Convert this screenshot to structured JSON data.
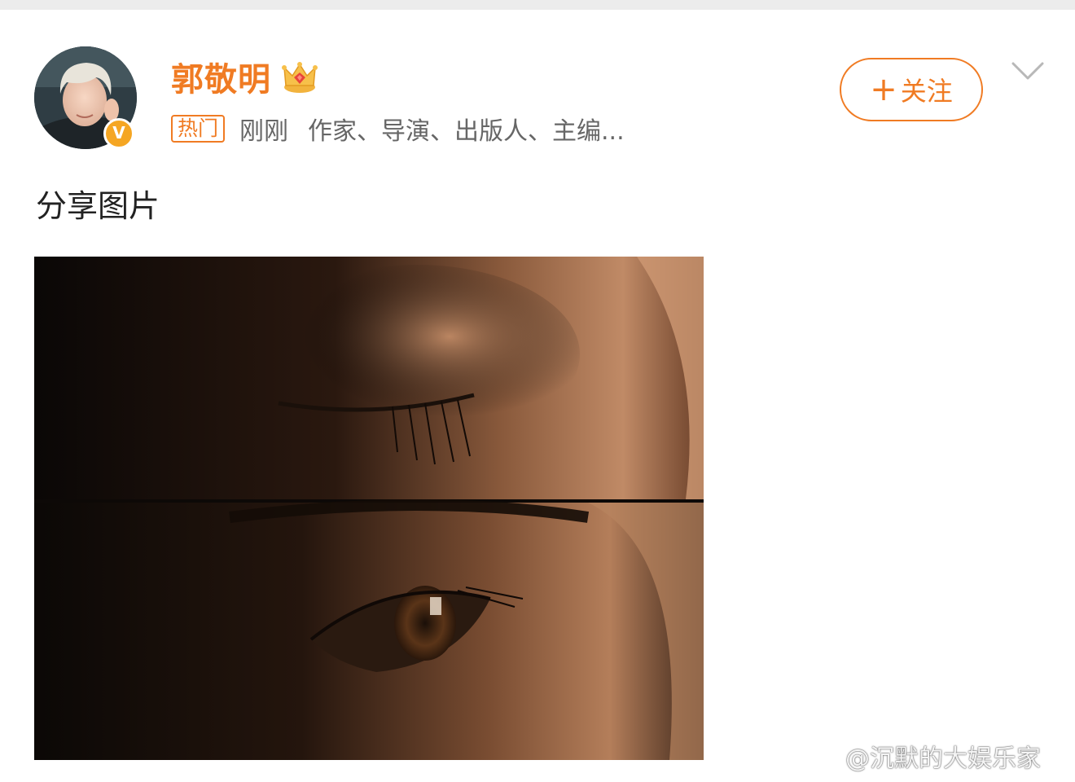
{
  "profile": {
    "username": "郭敬明",
    "verified_badge": "V",
    "hot_tag": "热门",
    "time": "刚刚",
    "bio": "作家、导演、出版人、主编..."
  },
  "follow_button": {
    "plus": "+",
    "label": "关注"
  },
  "post": {
    "text": "分享图片"
  },
  "watermark": {
    "text": "@沉默的大娱乐家"
  },
  "colors": {
    "accent": "#f07b23",
    "badge": "#f5a623",
    "meta_text": "#666666"
  },
  "icons": {
    "crown": "crown-icon",
    "chevron": "chevron-down-icon",
    "weibo": "weibo-logo-icon"
  }
}
